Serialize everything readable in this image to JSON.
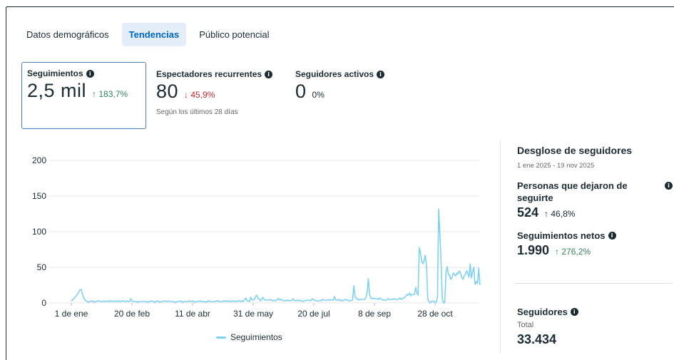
{
  "tabs": [
    {
      "label": "Datos demográficos"
    },
    {
      "label": "Tendencias"
    },
    {
      "label": "Público potencial"
    }
  ],
  "metrics": [
    {
      "label": "Seguimientos",
      "value": "2,5 mil",
      "change": "↑ 183,7%"
    },
    {
      "label": "Espectadores recurrentes",
      "value": "80",
      "change": "↓ 45,9%",
      "note": "Según los últimos 28 días"
    },
    {
      "label": "Seguidores activos",
      "value": "0",
      "change": "0%"
    }
  ],
  "colors": {
    "accent": "#0064d1",
    "up": "#31845b",
    "down": "#c4282b",
    "series": "#7fd1f4"
  },
  "chart_data": {
    "type": "line",
    "series": [
      {
        "name": "Seguimientos"
      }
    ],
    "y_ticks": [
      "0",
      "50",
      "100",
      "150",
      "200"
    ],
    "ylim": [
      0,
      200
    ],
    "x_ticks": [
      "1 de ene",
      "20 de feb",
      "11 de abr",
      "31 de may",
      "20 de jul",
      "8 de sep",
      "28 de oct"
    ],
    "x_tick_days": [
      0,
      50,
      100,
      150,
      200,
      250,
      300
    ],
    "daily_values": [
      3,
      4,
      6,
      8,
      10,
      12,
      15,
      18,
      19,
      14,
      8,
      5,
      3,
      2,
      1,
      2,
      2,
      3,
      2,
      1,
      2,
      2,
      3,
      3,
      2,
      2,
      2,
      3,
      2,
      2,
      2,
      3,
      2,
      3,
      2,
      2,
      3,
      2,
      2,
      3,
      2,
      2,
      3,
      3,
      2,
      2,
      3,
      2,
      2,
      6,
      3,
      2,
      2,
      2,
      2,
      1,
      2,
      2,
      2,
      2,
      2,
      2,
      2,
      1,
      2,
      2,
      3,
      2,
      2,
      1,
      2,
      3,
      2,
      1,
      2,
      2,
      2,
      3,
      2,
      2,
      3,
      2,
      2,
      2,
      2,
      1,
      1,
      2,
      2,
      2,
      3,
      2,
      1,
      2,
      2,
      2,
      2,
      3,
      2,
      2,
      3,
      2,
      1,
      2,
      2,
      2,
      3,
      2,
      2,
      2,
      2,
      1,
      2,
      3,
      2,
      2,
      2,
      2,
      2,
      2,
      3,
      3,
      2,
      2,
      2,
      2,
      3,
      2,
      3,
      2,
      3,
      2,
      2,
      3,
      2,
      2,
      3,
      2,
      3,
      3,
      2,
      3,
      2,
      5,
      7,
      3,
      3,
      2,
      8,
      5,
      4,
      5,
      9,
      11,
      6,
      6,
      3,
      5,
      8,
      5,
      4,
      4,
      4,
      4,
      5,
      4,
      3,
      4,
      3,
      3,
      6,
      6,
      4,
      5,
      4,
      3,
      3,
      4,
      3,
      4,
      3,
      3,
      4,
      6,
      3,
      3,
      4,
      3,
      4,
      3,
      3,
      2,
      3,
      3,
      4,
      4,
      4,
      3,
      4,
      6,
      4,
      4,
      3,
      3,
      3,
      3,
      3,
      5,
      4,
      4,
      4,
      4,
      4,
      5,
      4,
      4,
      4,
      9,
      5,
      4,
      4,
      5,
      3,
      4,
      3,
      4,
      5,
      4,
      4,
      3,
      3,
      4,
      4,
      24,
      10,
      6,
      6,
      4,
      5,
      5,
      5,
      5,
      5,
      8,
      15,
      34,
      12,
      7,
      6,
      7,
      6,
      6,
      6,
      5,
      7,
      6,
      5,
      4,
      4,
      4,
      4,
      6,
      5,
      5,
      5,
      5,
      6,
      5,
      5,
      5,
      6,
      7,
      5,
      6,
      7,
      8,
      10,
      12,
      11,
      14,
      10,
      12,
      12,
      12,
      22,
      14,
      11,
      78,
      70,
      58,
      55,
      60,
      67,
      50,
      5,
      2,
      0,
      2,
      3,
      2,
      1,
      1,
      9,
      132,
      96,
      55,
      5,
      0,
      1,
      42,
      51,
      40,
      39,
      33,
      36,
      42,
      40,
      38,
      42,
      41,
      45,
      42,
      36,
      33,
      38,
      40,
      45,
      42,
      36,
      55,
      35,
      44,
      50,
      26,
      30,
      27,
      49,
      25
    ]
  },
  "breakdown": {
    "title": "Desglose de seguidores",
    "range": "1 ene 2025 - 19 nov 2025",
    "unfollows_label": "Personas que dejaron de seguirte",
    "unfollows_value": "524",
    "unfollows_change": "↑ 46,8%",
    "net_label": "Seguimientos netos",
    "net_value": "1.990",
    "net_change": "↑ 276,2%",
    "followers_label": "Seguidores",
    "followers_sub": "Total",
    "followers_value": "33.434"
  }
}
